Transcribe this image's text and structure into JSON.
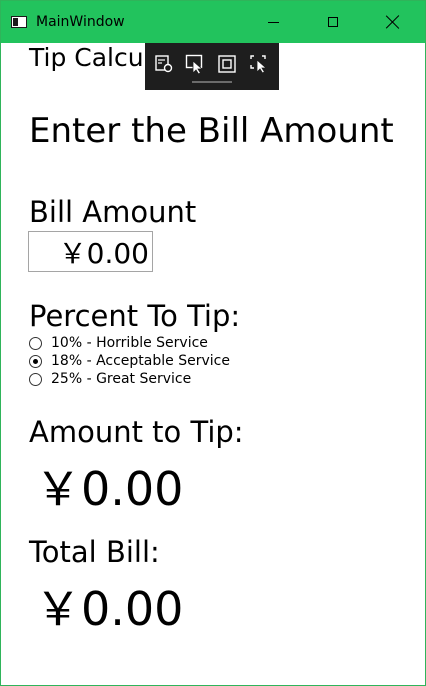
{
  "window": {
    "title": "MainWindow",
    "accent_color": "#22c35d"
  },
  "debug_toolbar": {
    "buttons": [
      "live-visual-tree-icon",
      "select-element-icon",
      "display-layout-adorners-icon",
      "track-focused-element-icon"
    ]
  },
  "app": {
    "title": "Tip Calcul",
    "heading": "Enter the Bill Amount",
    "bill_label": "Bill Amount",
    "bill_value": "￥0.00",
    "percent_label": "Percent To Tip:",
    "tip_options": [
      {
        "label": "10% - Horrible Service",
        "checked": false
      },
      {
        "label": "18% - Acceptable Service",
        "checked": true
      },
      {
        "label": "25% - Great Service",
        "checked": false
      }
    ],
    "tip_amount_label": "Amount to Tip:",
    "tip_amount_value": "￥0.00",
    "total_label": "Total Bill:",
    "total_value": "￥0.00"
  }
}
